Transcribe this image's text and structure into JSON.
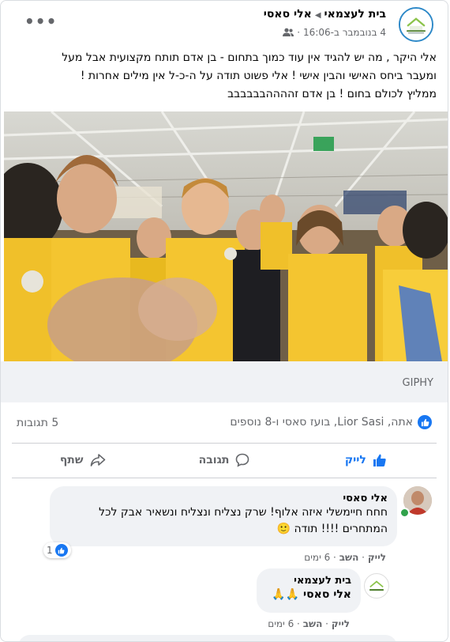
{
  "post": {
    "page_name": "בית לעצמאי",
    "author": "אלי סאסי",
    "date": "4 בנובמבר ב-16:06",
    "dot": "·",
    "more": "•••",
    "text_lines": [
      "אלי היקר , מה יש להגיד אין עוד כמוך בתחום - בן אדם תותח מקצועית אבל מעל",
      "ומעבר ביחס האישי והבין אישי ! אלי פשוט תודה על ה-כ-ל אין מילים אחרות !",
      "ממליץ לכולם בחום ! בן אדם זההההבבבבבב"
    ]
  },
  "media": {
    "source_label": "GIPHY"
  },
  "reactions": {
    "summary": "אתה, Lior Sasi, בועז סאסי ו-8 נוספים",
    "comments_count": "5 תגובות"
  },
  "actions": {
    "like": "לייק",
    "comment": "תגובה",
    "share": "שתף"
  },
  "comments": [
    {
      "name": "אלי סאסי",
      "text_lines": [
        "חחח חיימשלי איזה אלוף! שרק נצליח ונצליח ונשאיר אבק לכל",
        "המתחרים !!!! תודה 🙂"
      ],
      "like": "לייק",
      "reply": "השב",
      "time": "6 ימים",
      "reaction_count": "1"
    },
    {
      "name": "בית לעצמאי",
      "text": "אלי סאסי 🙏🙏",
      "like": "לייק",
      "reply": "השב",
      "time": "6 ימים"
    }
  ],
  "colors": {
    "accent": "#1877f2",
    "online": "#31a24c",
    "muted": "#65676b",
    "bubble": "#f0f2f5"
  },
  "icons": [
    "more-icon",
    "friends-icon",
    "like-icon",
    "comment-icon",
    "share-icon"
  ]
}
